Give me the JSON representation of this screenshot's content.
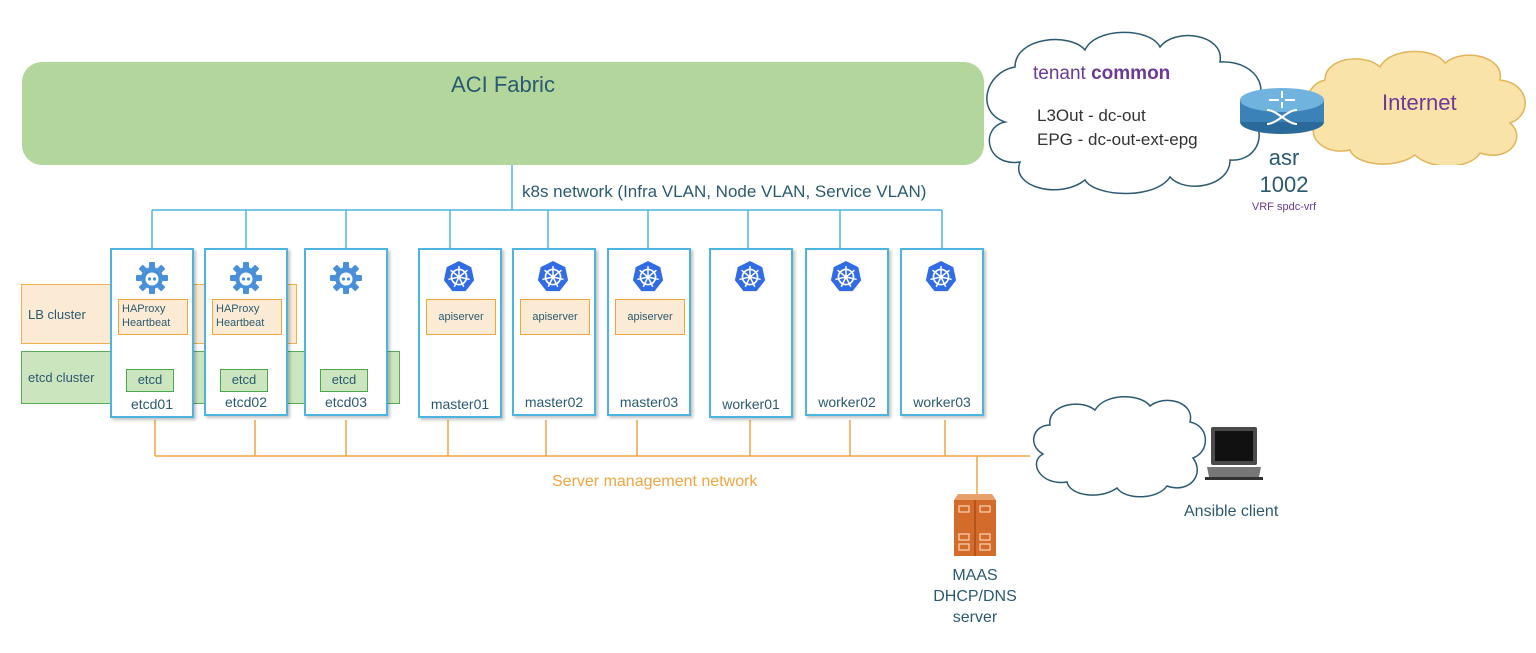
{
  "fabric": {
    "title": "ACI Fabric"
  },
  "tenant_cloud": {
    "title_prefix": "tenant ",
    "title_bold": "common",
    "line1": "L3Out - dc-out",
    "line2": "EPG - dc-out-ext-epg"
  },
  "router": {
    "name_line1": "asr",
    "name_line2": "1002",
    "vrf": "VRF spdc-vrf"
  },
  "internet": {
    "label": "Internet"
  },
  "k8s_network": {
    "label": "k8s network (Infra VLAN, Node VLAN, Service VLAN)"
  },
  "clusters": {
    "lb": "LB cluster",
    "etcd": "etcd cluster"
  },
  "nodes": [
    {
      "name": "etcd01",
      "icon": "etcd-icon",
      "service": "HAProxy Heartbeat",
      "etcd": "etcd"
    },
    {
      "name": "etcd02",
      "icon": "etcd-icon",
      "service": "HAProxy Heartbeat",
      "etcd": "etcd"
    },
    {
      "name": "etcd03",
      "icon": "etcd-icon",
      "service": "",
      "etcd": "etcd"
    },
    {
      "name": "master01",
      "icon": "kubernetes-icon",
      "service": "apiserver"
    },
    {
      "name": "master02",
      "icon": "kubernetes-icon",
      "service": "apiserver"
    },
    {
      "name": "master03",
      "icon": "kubernetes-icon",
      "service": "apiserver"
    },
    {
      "name": "worker01",
      "icon": "kubernetes-icon"
    },
    {
      "name": "worker02",
      "icon": "kubernetes-icon"
    },
    {
      "name": "worker03",
      "icon": "kubernetes-icon"
    }
  ],
  "haproxy": {
    "line1": "HAProxy",
    "line2": "Heartbeat"
  },
  "management": {
    "label": "Server management network"
  },
  "maas": {
    "line1": "MAAS",
    "line2": "DHCP/DNS",
    "line3": "server"
  },
  "ansible": {
    "label": "Ansible client"
  },
  "colors": {
    "k8s_line": "#4db4e2",
    "mgmt_line": "#f0a540",
    "fabric": "#b3d69c",
    "text": "#2b5a70",
    "accent_purple": "#6a3a96"
  }
}
